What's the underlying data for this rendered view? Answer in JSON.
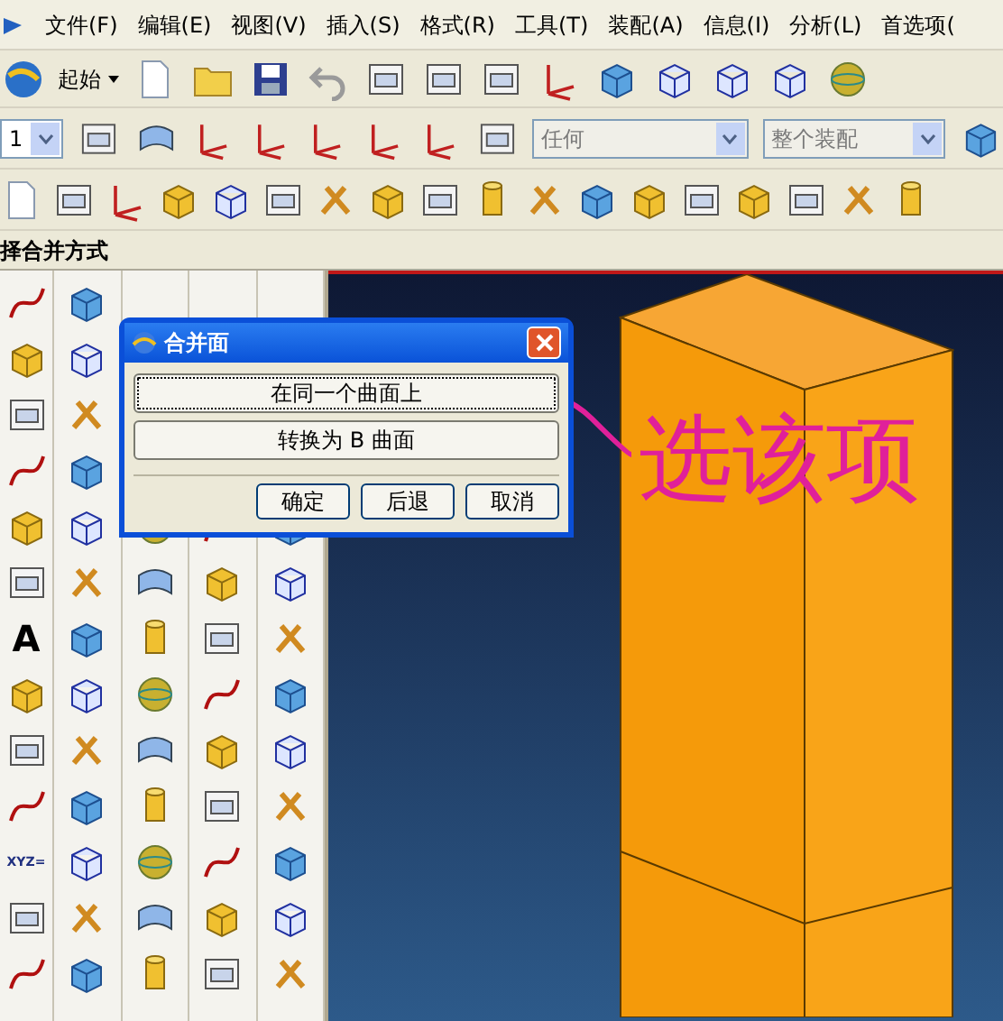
{
  "menu_bar": {
    "items": [
      "文件(F)",
      "编辑(E)",
      "视图(V)",
      "插入(S)",
      "格式(R)",
      "工具(T)",
      "装配(A)",
      "信息(I)",
      "分析(L)",
      "首选项("
    ]
  },
  "toolbar": {
    "start_button": "起始",
    "layer_select": {
      "value": "1"
    },
    "filter_select": {
      "value": "任何",
      "disabled": true
    },
    "scope_select": {
      "value": "整个装配",
      "disabled": true
    }
  },
  "prompt": "择合并方式",
  "palette_glyphs": [
    {
      "label": "A"
    },
    {
      "label": "XYZ="
    }
  ],
  "dialog": {
    "title": "合并面",
    "options": [
      {
        "label": "在同一个曲面上",
        "focused": true
      },
      {
        "label": "转换为 B 曲面",
        "focused": false
      }
    ],
    "buttons": [
      "确定",
      "后退",
      "取消"
    ]
  },
  "annotation": {
    "text": "选该项"
  }
}
